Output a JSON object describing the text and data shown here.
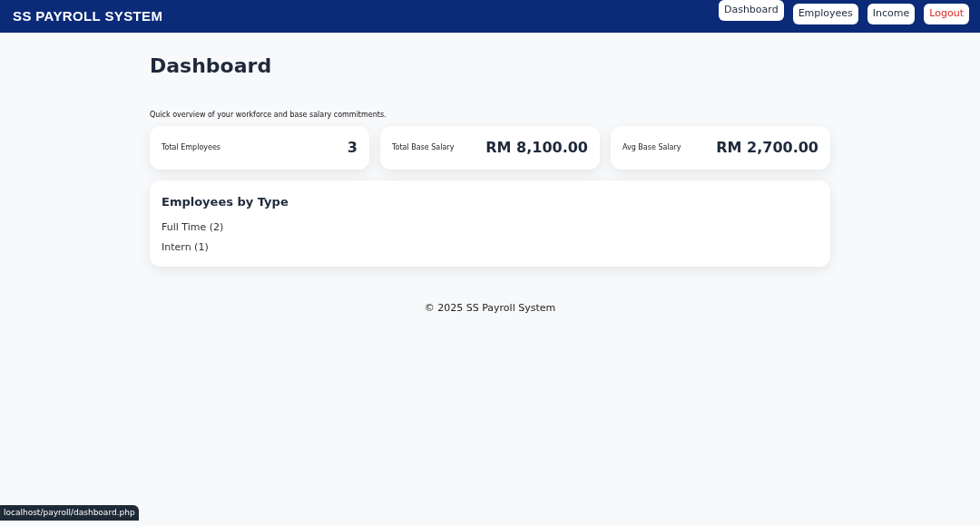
{
  "header": {
    "brand": "SS PAYROLL SYSTEM",
    "nav": [
      {
        "label": "Dashboard",
        "selected": true,
        "kind": "link"
      },
      {
        "label": "Employees",
        "selected": false,
        "kind": "link"
      },
      {
        "label": "Income",
        "selected": false,
        "kind": "link"
      },
      {
        "label": "Logout",
        "selected": false,
        "kind": "danger"
      }
    ]
  },
  "page": {
    "title": "Dashboard",
    "subtitle": "Quick overview of your workforce and base salary commitments."
  },
  "stats": [
    {
      "label": "Total Employees",
      "value": "3"
    },
    {
      "label": "Total Base Salary",
      "value": "RM 8,100.00"
    },
    {
      "label": "Avg Base Salary",
      "value": "RM 2,700.00"
    }
  ],
  "employees_by_type": {
    "title": "Employees by Type",
    "items": [
      "Full Time (2)",
      "Intern (1)"
    ]
  },
  "footer": "© 2025 SS Payroll System",
  "status_bar": {
    "url": "localhost/payroll/dashboard.php"
  }
}
